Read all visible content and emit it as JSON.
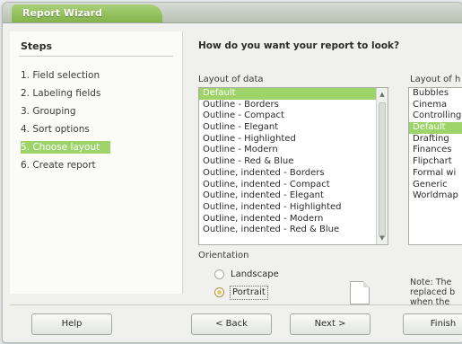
{
  "window": {
    "title": "Report Wizard"
  },
  "steps": {
    "title": "Steps",
    "items": [
      {
        "label": "1. Field selection"
      },
      {
        "label": "2. Labeling fields"
      },
      {
        "label": "3. Grouping"
      },
      {
        "label": "4. Sort options"
      },
      {
        "label": "5. Choose layout"
      },
      {
        "label": "6. Create report"
      }
    ],
    "active_index": 4
  },
  "main": {
    "question": "How do you want your report to look?",
    "layout_of_data": {
      "label": "Layout of data",
      "items": [
        "Default",
        "Outline - Borders",
        "Outline - Compact",
        "Outline - Elegant",
        "Outline - Highlighted",
        "Outline - Modern",
        "Outline - Red & Blue",
        "Outline, indented - Borders",
        "Outline, indented - Compact",
        "Outline, indented - Elegant",
        "Outline, indented - Highlighted",
        "Outline, indented - Modern",
        "Outline, indented - Red & Blue"
      ],
      "selected": "Default"
    },
    "layout_of_headers": {
      "label": "Layout of h",
      "items": [
        "Bubbles",
        "Cinema",
        "Controlling",
        "Default",
        "Drafting",
        "Finances",
        "Flipchart",
        "Formal wi",
        "Generic",
        "Worldmap"
      ],
      "selected": "Default"
    },
    "orientation": {
      "label": "Orientation",
      "options": [
        "Landscape",
        "Portrait"
      ],
      "selected": "Portrait"
    },
    "note": [
      "Note: The",
      "replaced b",
      "when the"
    ]
  },
  "buttons": {
    "help": "Help",
    "back": "< Back",
    "next": "Next >",
    "finish": "Finish"
  },
  "colors": {
    "accent": "#9ed36a",
    "title_bar": "#8fbd54"
  }
}
